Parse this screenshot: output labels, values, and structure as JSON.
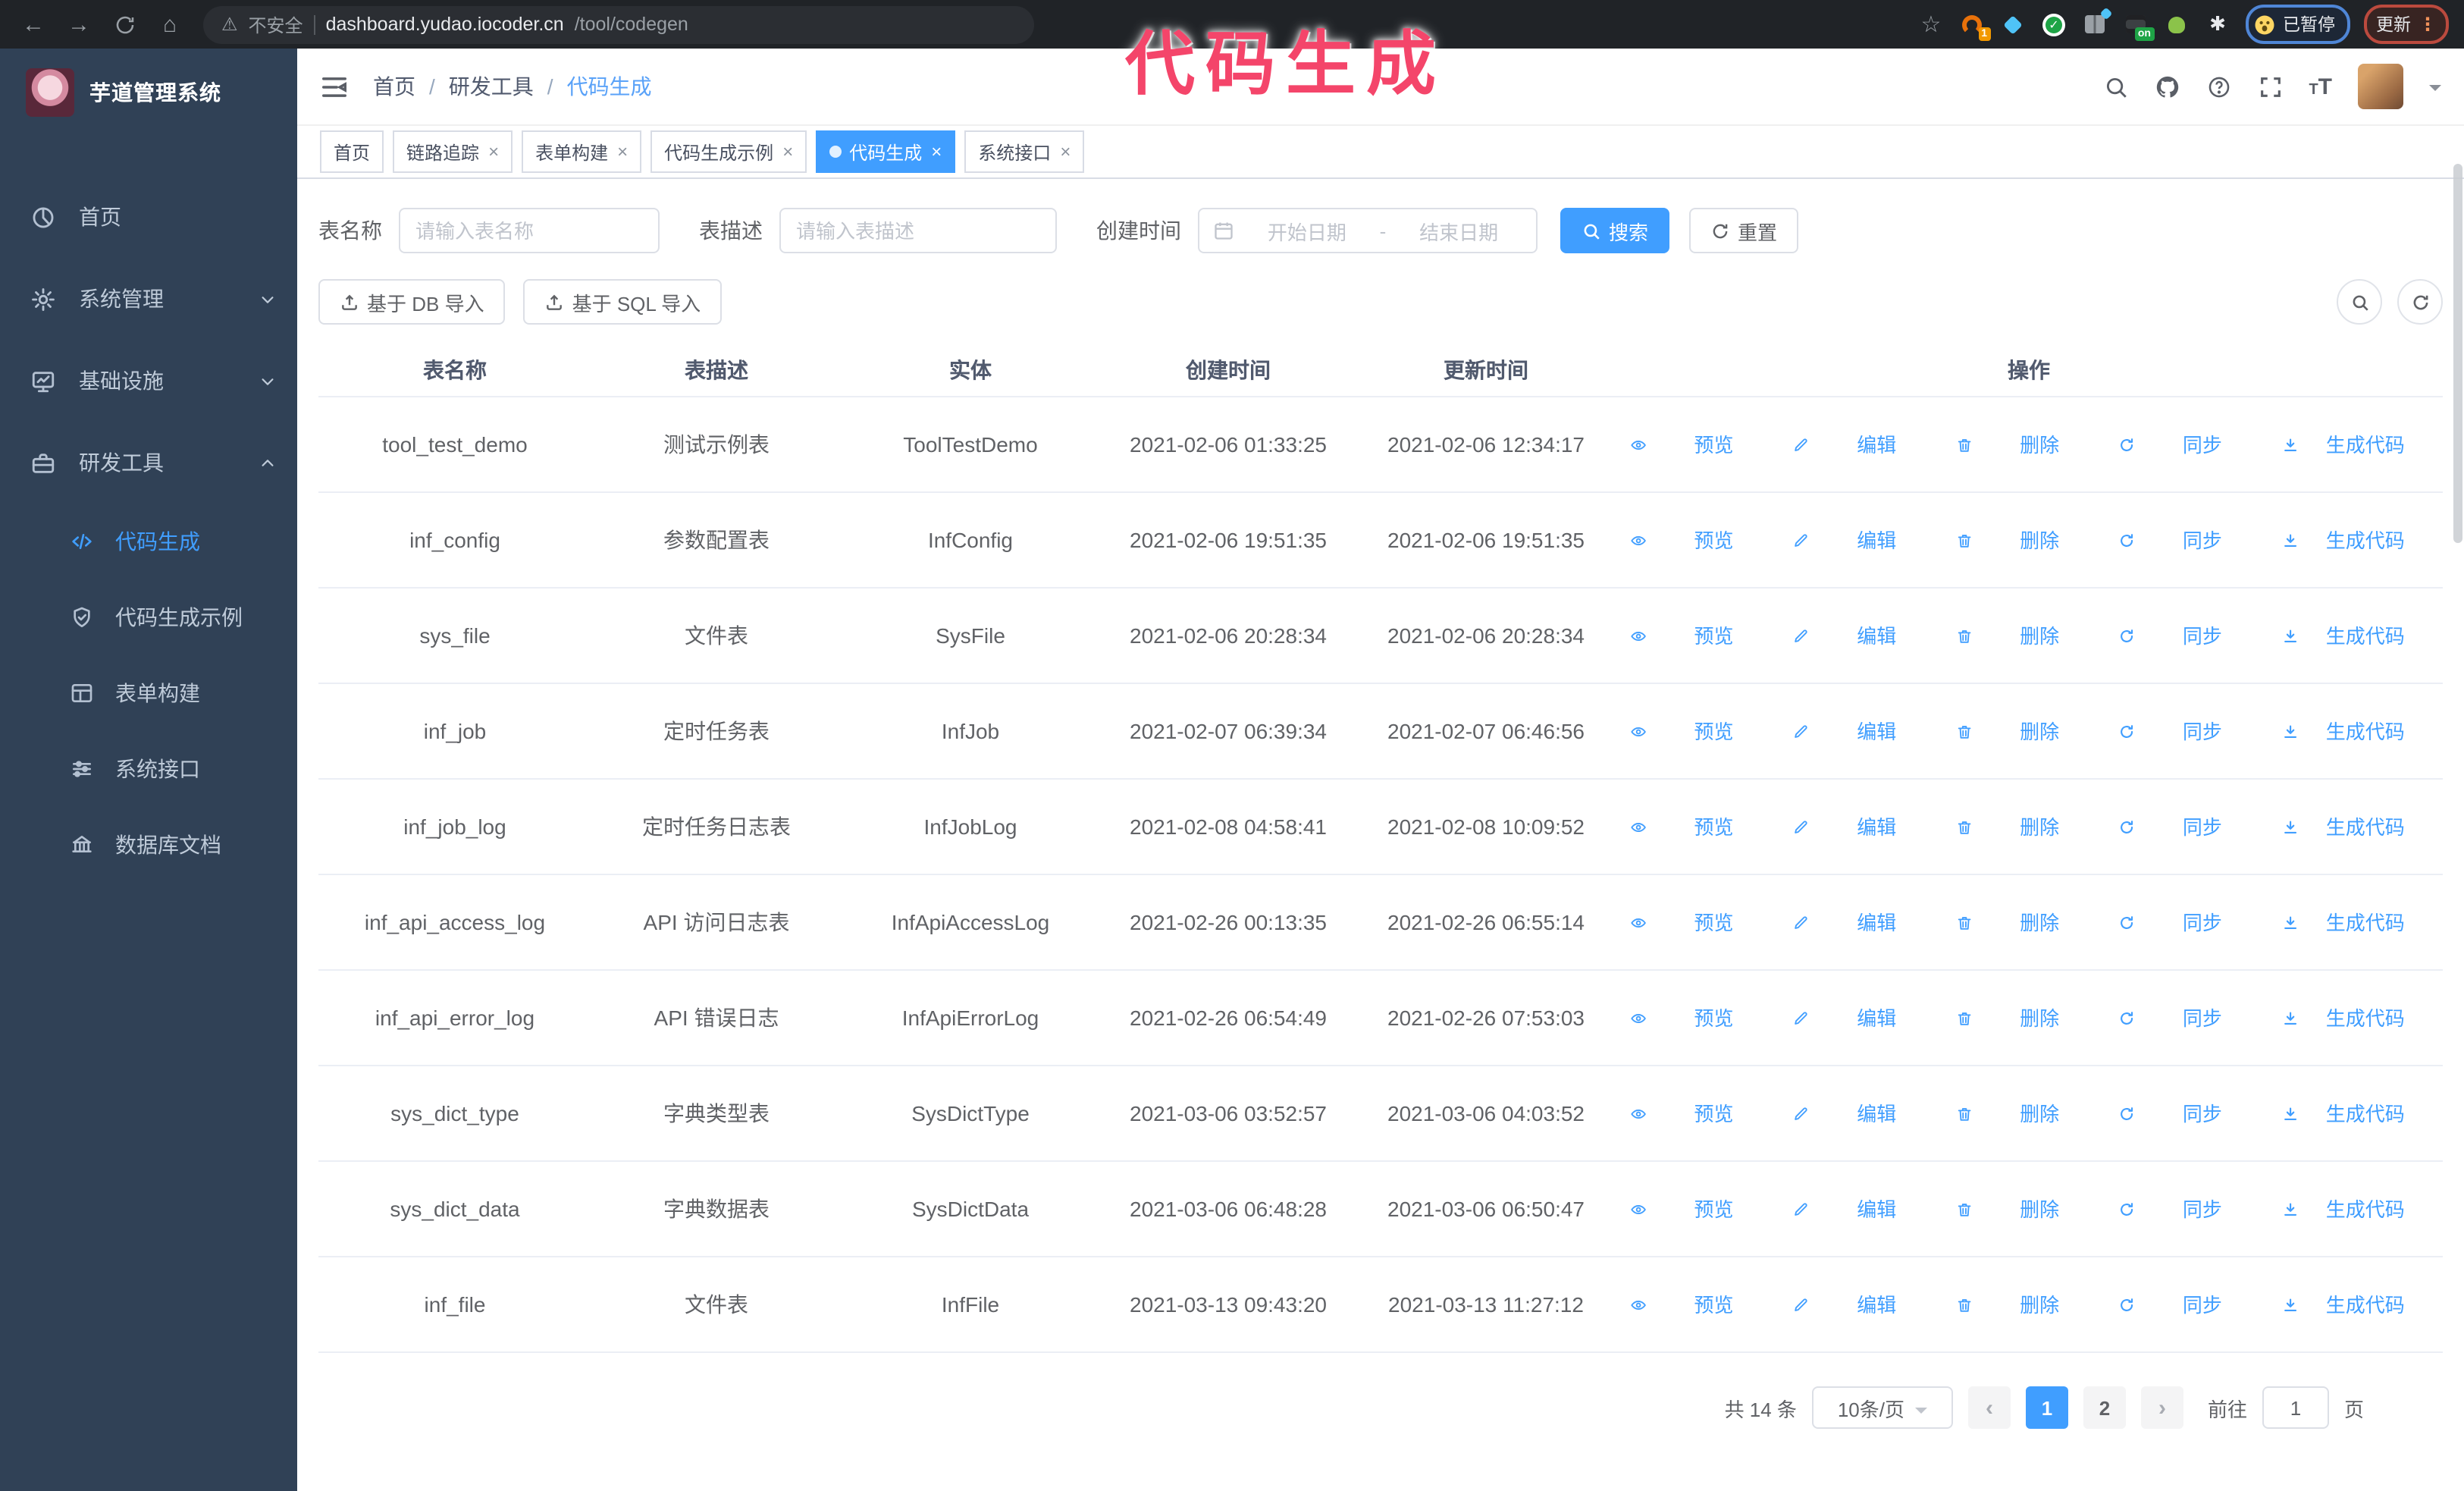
{
  "browser": {
    "security": "不安全",
    "url_host": "dashboard.yudao.iocoder.cn",
    "url_path": "/tool/codegen",
    "paused_badge": "已暂停",
    "update_label": "更新",
    "extensions": [
      {
        "name": "orange-circle-extension",
        "badge": "1"
      },
      {
        "name": "blue-gem-extension",
        "badge": ""
      },
      {
        "name": "green-check-extension",
        "badge": ""
      },
      {
        "name": "panels-extension",
        "badge": ""
      },
      {
        "name": "dark-panel-extension",
        "badge": "on"
      },
      {
        "name": "green-frog-extension",
        "badge": ""
      },
      {
        "name": "puzzle-extension",
        "badge": ""
      }
    ]
  },
  "annotation": {
    "text": "代码生成"
  },
  "sidebar": {
    "title": "芋道管理系统",
    "items": [
      {
        "label": "首页",
        "icon": "dashboard",
        "chevron": ""
      },
      {
        "label": "系统管理",
        "icon": "gear",
        "chevron": "down"
      },
      {
        "label": "基础设施",
        "icon": "monitor",
        "chevron": "down"
      },
      {
        "label": "研发工具",
        "icon": "toolbox",
        "chevron": "up"
      }
    ],
    "subitems": [
      {
        "label": "代码生成",
        "icon": "code",
        "active": true
      },
      {
        "label": "代码生成示例",
        "icon": "shield",
        "active": false
      },
      {
        "label": "表单构建",
        "icon": "form",
        "active": false
      },
      {
        "label": "系统接口",
        "icon": "sliders",
        "active": false
      },
      {
        "label": "数据库文档",
        "icon": "bank",
        "active": false
      }
    ]
  },
  "breadcrumb": [
    "首页",
    "研发工具",
    "代码生成"
  ],
  "tabs": [
    {
      "label": "首页",
      "closable": false,
      "active": false
    },
    {
      "label": "链路追踪",
      "closable": true,
      "active": false
    },
    {
      "label": "表单构建",
      "closable": true,
      "active": false
    },
    {
      "label": "代码生成示例",
      "closable": true,
      "active": false
    },
    {
      "label": "代码生成",
      "closable": true,
      "active": true
    },
    {
      "label": "系统接口",
      "closable": true,
      "active": false
    }
  ],
  "filters": {
    "table_name_label": "表名称",
    "table_name_placeholder": "请输入表名称",
    "table_desc_label": "表描述",
    "table_desc_placeholder": "请输入表描述",
    "create_time_label": "创建时间",
    "date_start_placeholder": "开始日期",
    "date_sep": "-",
    "date_end_placeholder": "结束日期",
    "search_label": "搜索",
    "reset_label": "重置"
  },
  "toolbar": {
    "import_db": "基于 DB 导入",
    "import_sql": "基于 SQL 导入"
  },
  "table": {
    "columns": [
      "表名称",
      "表描述",
      "实体",
      "创建时间",
      "更新时间",
      "操作"
    ],
    "actions": [
      {
        "label": "预览",
        "icon": "eye"
      },
      {
        "label": "编辑",
        "icon": "edit"
      },
      {
        "label": "删除",
        "icon": "trash"
      },
      {
        "label": "同步",
        "icon": "sync"
      },
      {
        "label": "生成代码",
        "icon": "download"
      }
    ],
    "rows": [
      {
        "name": "tool_test_demo",
        "desc": "测试示例表",
        "entity": "ToolTestDemo",
        "created": "2021-02-06 01:33:25",
        "updated": "2021-02-06 12:34:17"
      },
      {
        "name": "inf_config",
        "desc": "参数配置表",
        "entity": "InfConfig",
        "created": "2021-02-06 19:51:35",
        "updated": "2021-02-06 19:51:35"
      },
      {
        "name": "sys_file",
        "desc": "文件表",
        "entity": "SysFile",
        "created": "2021-02-06 20:28:34",
        "updated": "2021-02-06 20:28:34"
      },
      {
        "name": "inf_job",
        "desc": "定时任务表",
        "entity": "InfJob",
        "created": "2021-02-07 06:39:34",
        "updated": "2021-02-07 06:46:56"
      },
      {
        "name": "inf_job_log",
        "desc": "定时任务日志表",
        "entity": "InfJobLog",
        "created": "2021-02-08 04:58:41",
        "updated": "2021-02-08 10:09:52"
      },
      {
        "name": "inf_api_access_log",
        "desc": "API 访问日志表",
        "entity": "InfApiAccessLog",
        "created": "2021-02-26 00:13:35",
        "updated": "2021-02-26 06:55:14"
      },
      {
        "name": "inf_api_error_log",
        "desc": "API 错误日志",
        "entity": "InfApiErrorLog",
        "created": "2021-02-26 06:54:49",
        "updated": "2021-02-26 07:53:03"
      },
      {
        "name": "sys_dict_type",
        "desc": "字典类型表",
        "entity": "SysDictType",
        "created": "2021-03-06 03:52:57",
        "updated": "2021-03-06 04:03:52"
      },
      {
        "name": "sys_dict_data",
        "desc": "字典数据表",
        "entity": "SysDictData",
        "created": "2021-03-06 06:48:28",
        "updated": "2021-03-06 06:50:47"
      },
      {
        "name": "inf_file",
        "desc": "文件表",
        "entity": "InfFile",
        "created": "2021-03-13 09:43:20",
        "updated": "2021-03-13 11:27:12"
      }
    ]
  },
  "pagination": {
    "total": "共 14 条",
    "page_size": "10条/页",
    "pages": [
      "1",
      "2"
    ],
    "active_page": "1",
    "goto": "前往",
    "goto_value": "1",
    "unit": "页"
  },
  "colors": {
    "primary": "#409eff",
    "sidebar_bg": "#304156",
    "annotation": "#f4456a",
    "active_tab": "#409eff"
  }
}
